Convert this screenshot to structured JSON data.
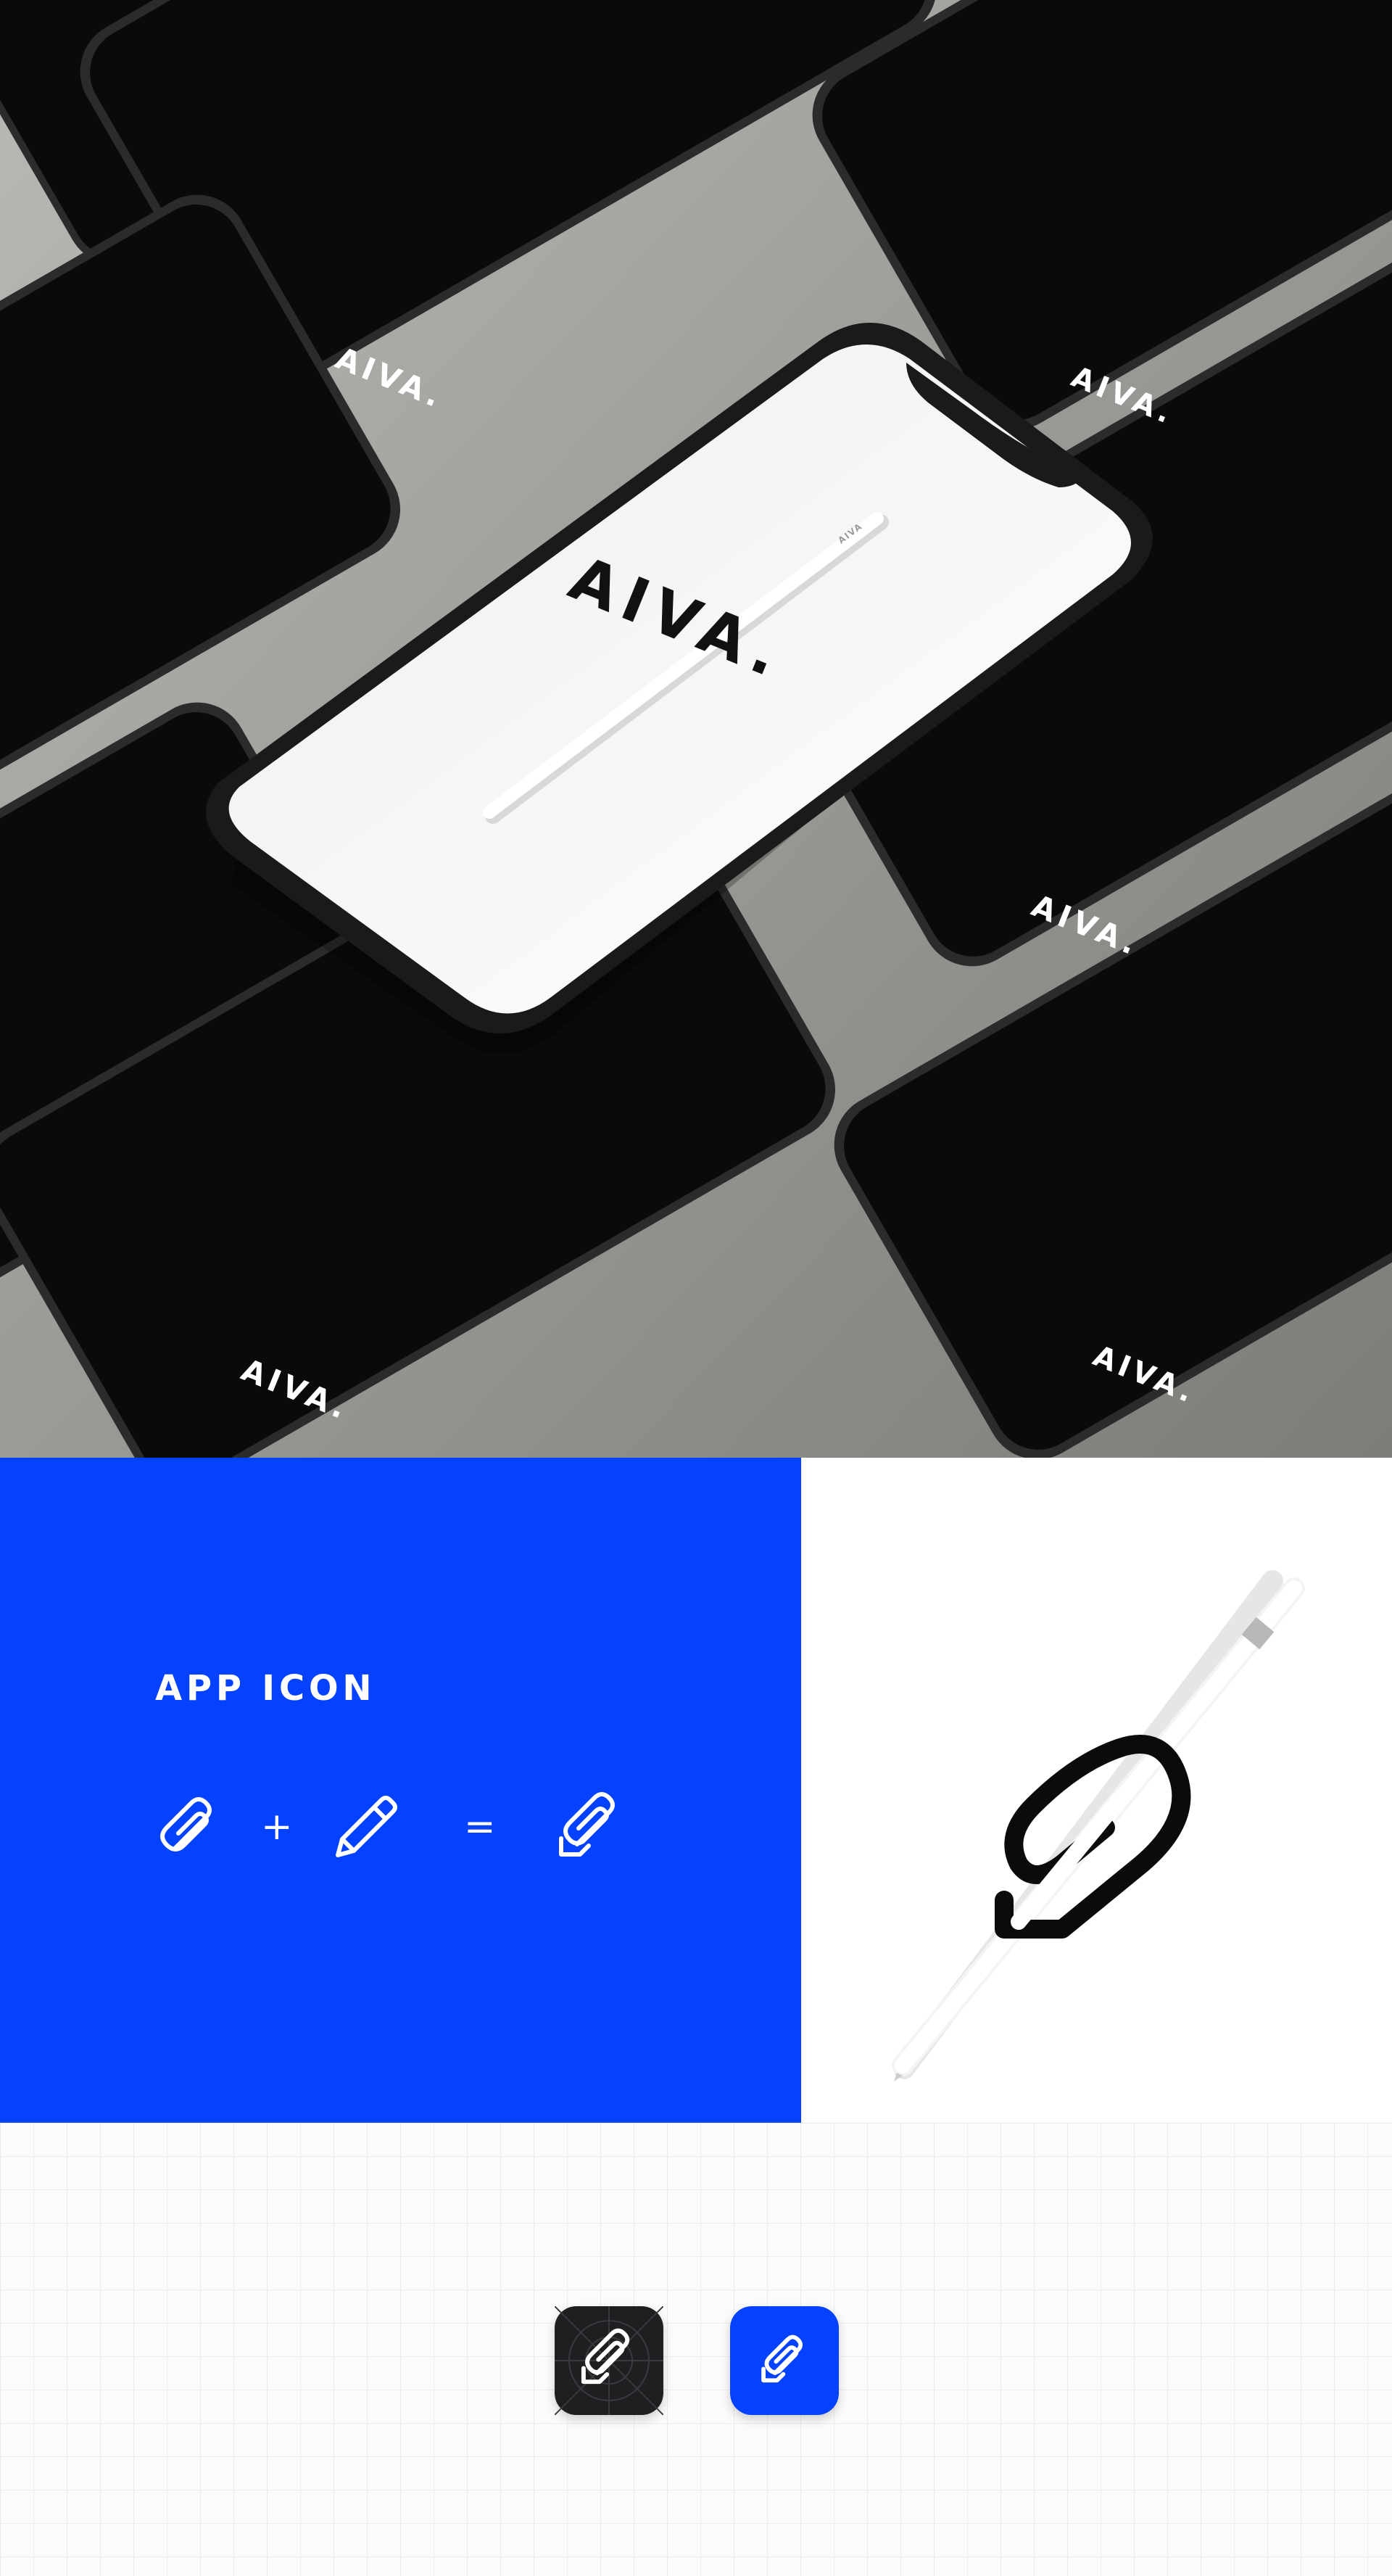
{
  "hero": {
    "brand_wordmark": "AIVA.",
    "stylus_marking": "AIVA"
  },
  "app_icon_section": {
    "heading": "APP ICON",
    "plus_sign": "+",
    "equals_sign": "=",
    "icons": [
      "paperclip-icon",
      "pencil-icon",
      "combined-clip-pencil-icon"
    ]
  },
  "icon_variants": [
    {
      "name": "dark-app-icon",
      "background": "#1f1f22"
    },
    {
      "name": "blue-app-icon",
      "background": "#0542ff"
    }
  ],
  "colors": {
    "brand_blue": "#0542ff",
    "phone_black": "#0a0a0a",
    "backdrop_grey": "#9c9c98"
  }
}
